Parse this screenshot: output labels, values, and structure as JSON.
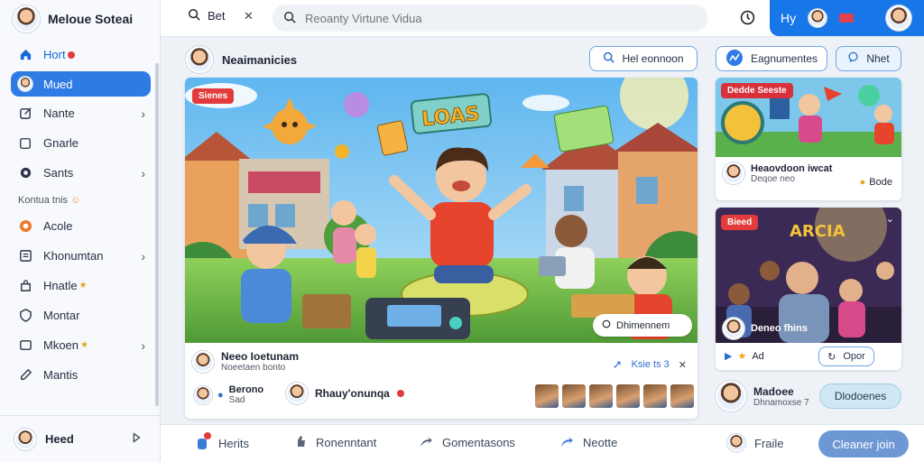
{
  "app": {
    "brand": "Meloue Soteai",
    "user_name": "Heed"
  },
  "sidebar": {
    "items": [
      {
        "label": "Hort",
        "icon": "home-icon"
      },
      {
        "label": "Mued",
        "icon": "profile-icon",
        "active": true
      },
      {
        "label": "Nante",
        "icon": "compose-icon"
      },
      {
        "label": "Gnarle",
        "icon": "square-icon"
      },
      {
        "label": "Sants",
        "icon": "settings-icon"
      }
    ],
    "section_label": "Kontua tnis",
    "items2": [
      {
        "label": "Acole",
        "icon": "circle-icon"
      },
      {
        "label": "Khonumtan",
        "icon": "list-icon"
      },
      {
        "label": "Hnatle",
        "icon": "bag-icon"
      },
      {
        "label": "Montar",
        "icon": "shield-icon"
      },
      {
        "label": "Mkoen",
        "icon": "box-icon"
      },
      {
        "label": "Mantis",
        "icon": "edit-icon"
      }
    ]
  },
  "topbar": {
    "tab_label": "Bet",
    "search_placeholder": "Reoanty Virtune Vidua",
    "account_label": "Hy"
  },
  "feed": {
    "header_title": "Neaimanicies",
    "btn_left": "Hel eonnoon",
    "btn_right_1": "Eagnumentes",
    "btn_right_2": "Nhet",
    "hero_badge": "Sienes",
    "hero_sign": "LOAS",
    "hero_pill": "Dhimennem",
    "author": "Neeo Ioetunam",
    "author_sub": "Noeetaen bonto",
    "link": "Ksie ts 3",
    "meta2_name": "Berono",
    "meta2_sub": "Sad",
    "meta3_name": "Rhauy'onunqa"
  },
  "side": {
    "card1_badge": "Dedde Seeste",
    "card1_name": "Heaovdoon iwcat",
    "card1_sub": "Deqoe neo",
    "card1_tag": "Bode",
    "card2_badge": "Bieed",
    "card2_sign": "ARCIA",
    "card2_name": "Deneo fhins",
    "card2_reacts": "Ad",
    "card2_btn": "Opor",
    "person_name": "Madoee",
    "person_sub": "Dhnamoxse 7",
    "person_btn": "Dlodoenes"
  },
  "bottombar": {
    "items": [
      "Herits",
      "Ronenntant",
      "Gomentasons",
      "Neotte",
      "Fraile"
    ],
    "cta": "Cleaner join"
  },
  "colors": {
    "accent": "#1877e8",
    "active_nav": "#2f7be6",
    "badge": "#e33b3b"
  }
}
